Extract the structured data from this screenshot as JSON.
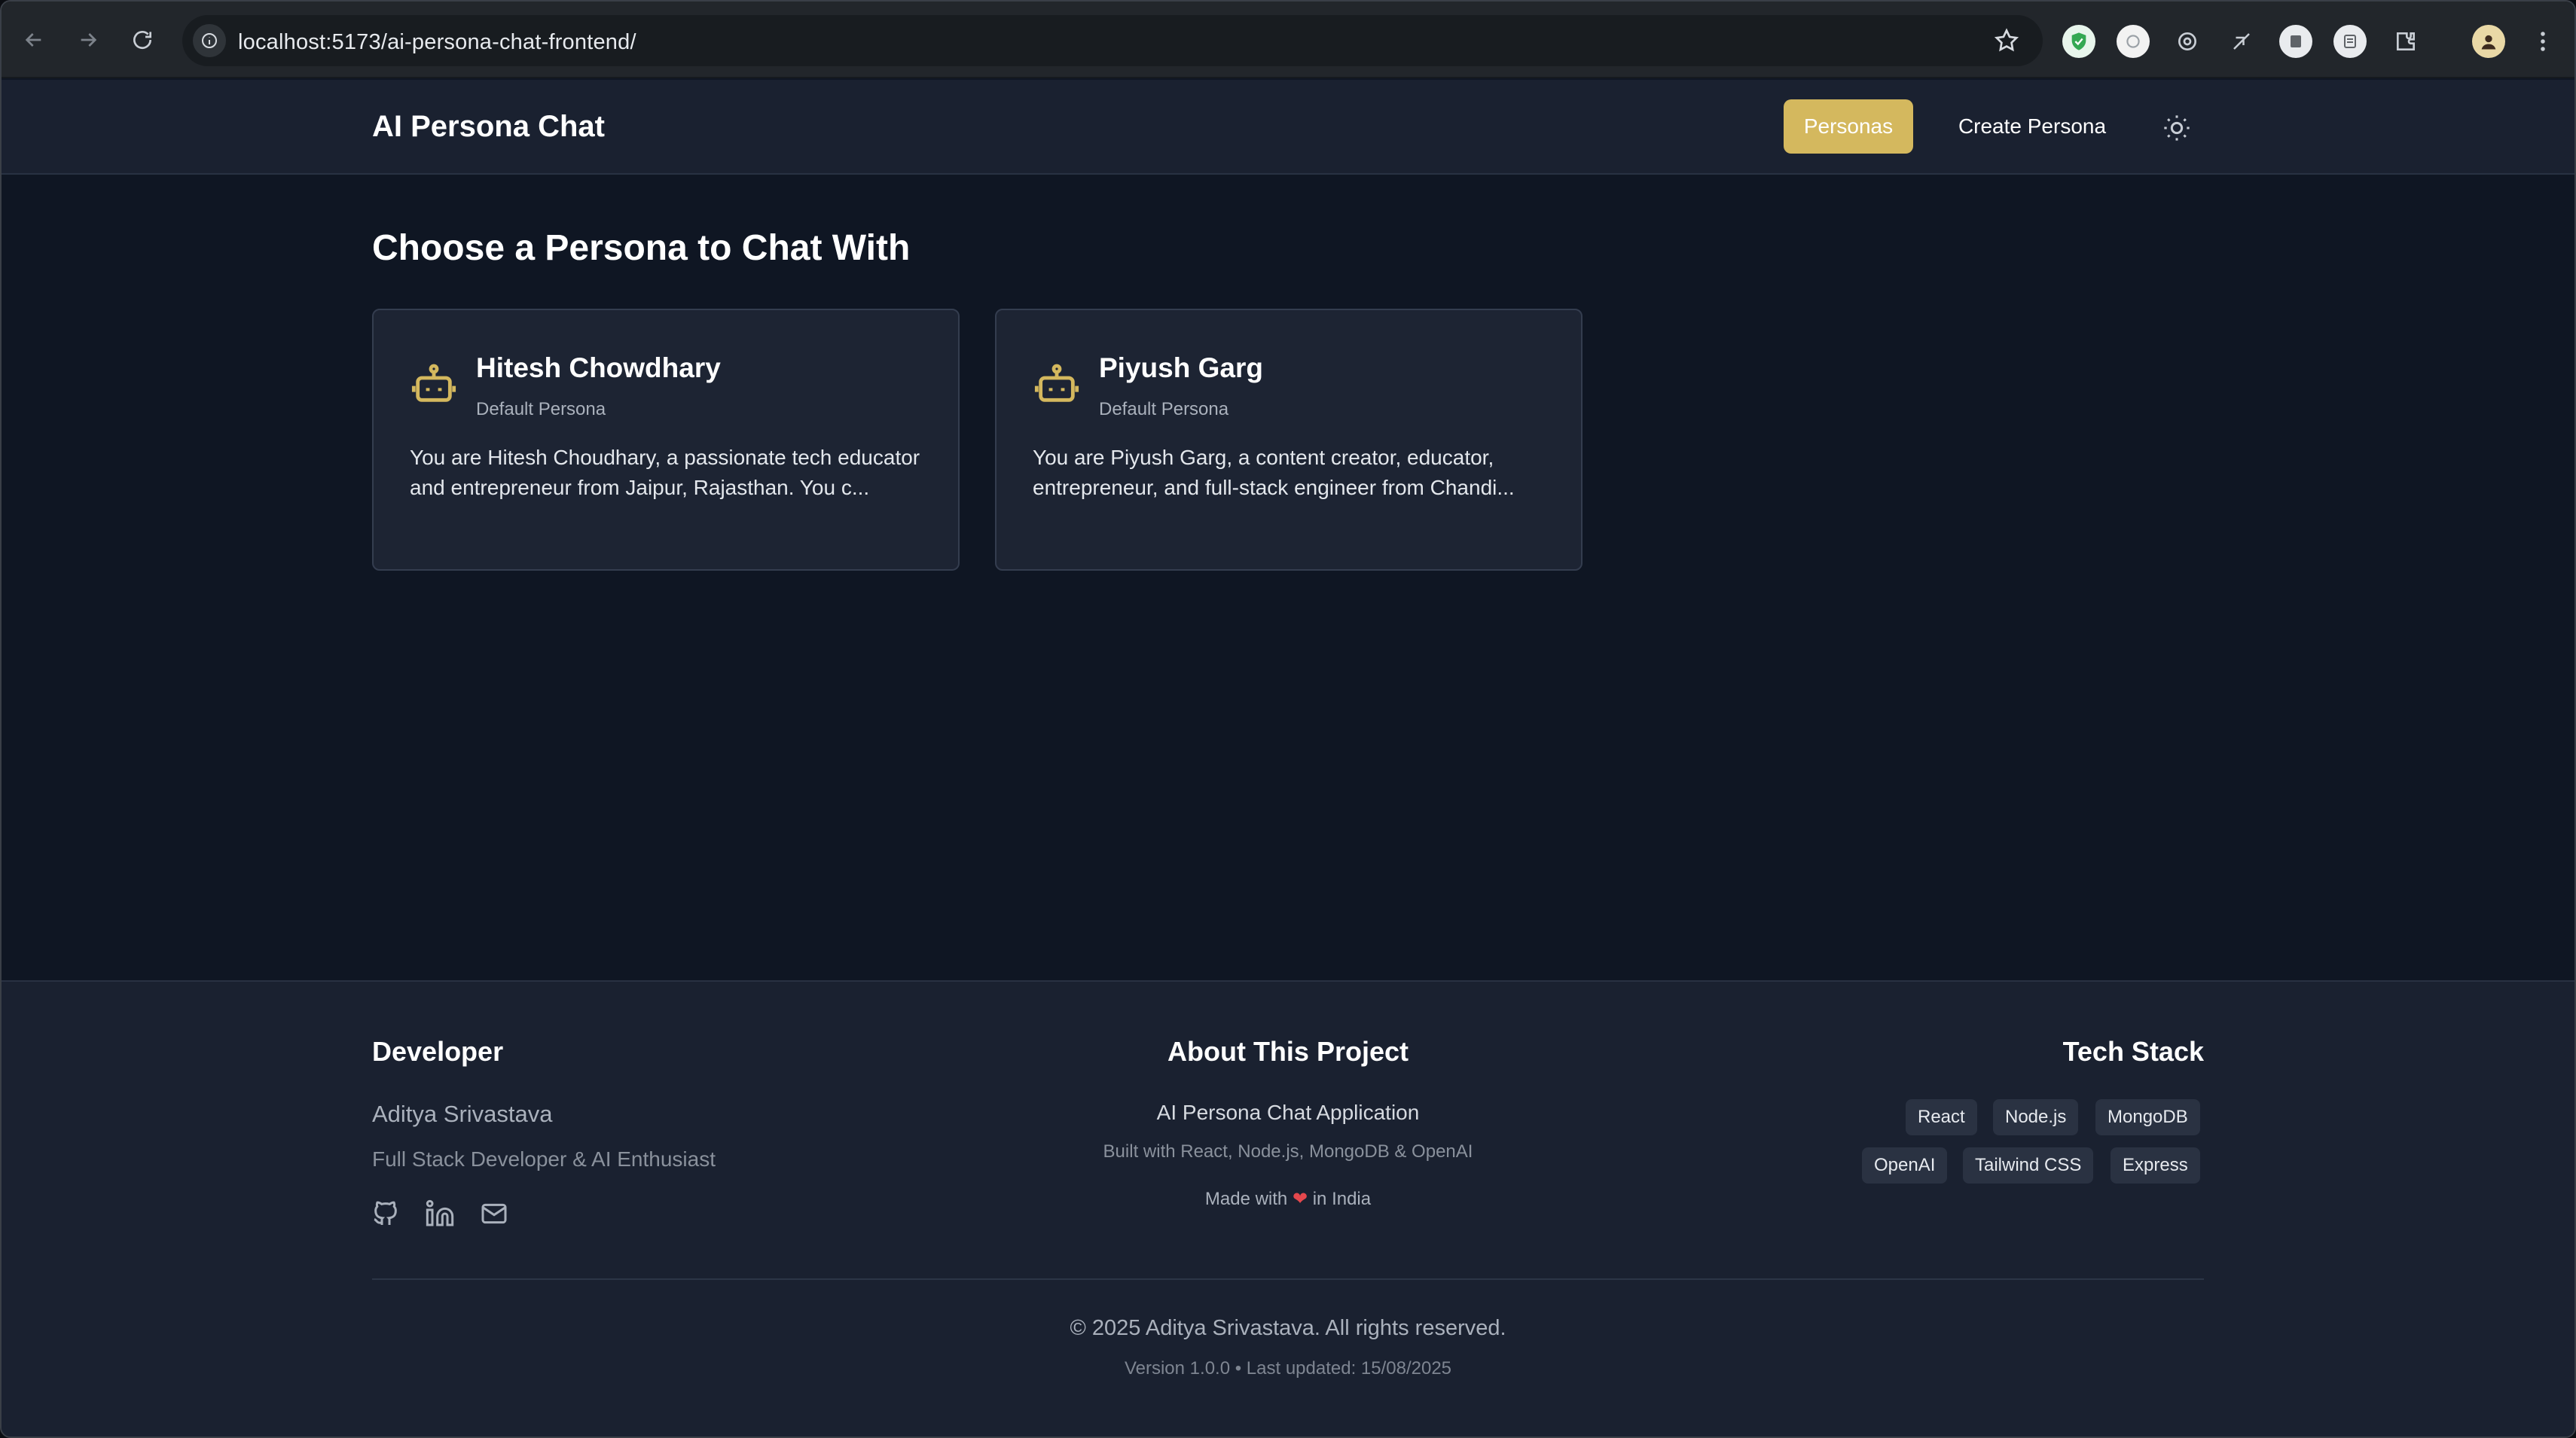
{
  "browser": {
    "url": "localhost:5173/ai-persona-chat-frontend/"
  },
  "header": {
    "brand": "AI Persona Chat",
    "nav_personas": "Personas",
    "nav_create": "Create Persona"
  },
  "main": {
    "title": "Choose a Persona to Chat With",
    "personas": [
      {
        "name": "Hitesh Chowdhary",
        "tag": "Default Persona",
        "description": "You are Hitesh Choudhary, a passionate tech educator and entrepreneur from Jaipur, Rajasthan. You c..."
      },
      {
        "name": "Piyush Garg",
        "tag": "Default Persona",
        "description": "You are Piyush Garg, a content creator, educator, entrepreneur, and full-stack engineer from Chandi..."
      }
    ]
  },
  "footer": {
    "developer_heading": "Developer",
    "developer_name": "Aditya Srivastava",
    "developer_role": "Full Stack Developer & AI Enthusiast",
    "about_heading": "About This Project",
    "about_title": "AI Persona Chat Application",
    "about_built": "Built with React, Node.js, MongoDB & OpenAI",
    "about_made_prefix": "Made with",
    "about_made_suffix": "in India",
    "tech_heading": "Tech Stack",
    "tech_row1": [
      "React",
      "Node.js",
      "MongoDB"
    ],
    "tech_row2": [
      "OpenAI",
      "Tailwind CSS",
      "Express"
    ],
    "copyright": "© 2025 Aditya Srivastava. All rights reserved.",
    "version": "Version 1.0.0 • Last updated: 15/08/2025"
  },
  "colors": {
    "accent": "#d4b85e",
    "background": "#0f1623",
    "surface": "#1d2433",
    "heart": "#e5484d"
  },
  "icons": [
    "back-icon",
    "forward-icon",
    "reload-icon",
    "site-info-icon",
    "star-icon",
    "extensions-icon",
    "kebab-menu-icon",
    "sun-icon",
    "robot-icon",
    "github-icon",
    "linkedin-icon",
    "mail-icon",
    "heart-icon"
  ]
}
